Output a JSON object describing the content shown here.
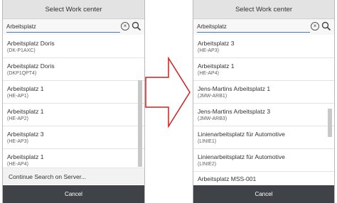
{
  "left": {
    "title": "Select Work center",
    "search_value": "Arbeitsplatz",
    "items": [
      {
        "title": "Arbeitsplatz Doris",
        "sub": "(DK-P1AXC)"
      },
      {
        "title": "Arbeitsplatz Doris",
        "sub": "(DKP1QPT4)"
      },
      {
        "title": "Arbeitsplatz 1",
        "sub": "(HE-AP1)"
      },
      {
        "title": "Arbeitsplatz 1",
        "sub": "(HE-AP2)"
      },
      {
        "title": "Arbeitsplatz 3",
        "sub": "(HE-AP3)"
      },
      {
        "title": "Arbeitsplatz 1",
        "sub": "(HE-AP4)"
      }
    ],
    "continue_label": "Continue Search on Server...",
    "cancel_label": "Cancel"
  },
  "right": {
    "title": "Select Work center",
    "search_value": "Arbeitsplatz",
    "items": [
      {
        "title": "Arbeitsplatz 3",
        "sub": "(HE-AP3)"
      },
      {
        "title": "Arbeitsplatz 1",
        "sub": "(HE-AP4)"
      },
      {
        "title": "Jens-Martins Arbeitsplatz 1",
        "sub": "(JMW-ARB1)"
      },
      {
        "title": "Jens-Martins Arbeitsplatz 3",
        "sub": "(JMW-ARB3)"
      },
      {
        "title": "Linienarbeitsplatz für Automotive",
        "sub": "(LINIE1)"
      },
      {
        "title": "Linienarbeitsplatz für Automotive",
        "sub": "(LINIE2)"
      },
      {
        "title": "Arbeitsplatz MSS-001",
        "sub": ""
      }
    ],
    "cancel_label": "Cancel"
  },
  "icons": {
    "clear": "clear-icon",
    "search": "search-icon",
    "arrow": "right-arrow-icon"
  },
  "colors": {
    "footer": "#3f4347",
    "arrow": "#d21f1f",
    "title_bar": "#e3e3e3",
    "input_underline": "#3a7ec5"
  }
}
